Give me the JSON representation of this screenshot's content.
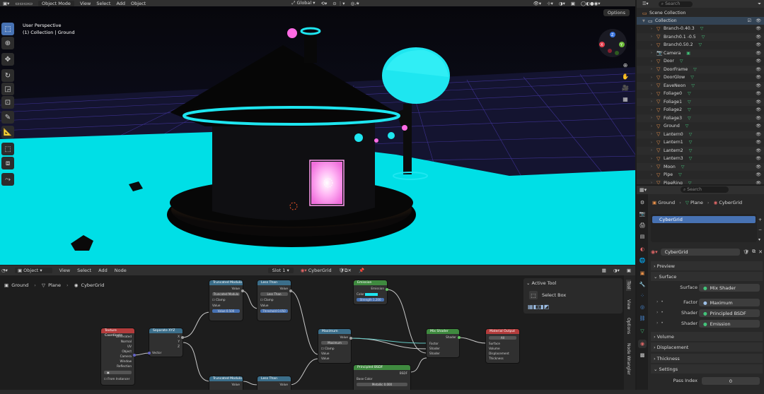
{
  "viewport_header": {
    "mode": "Object Mode",
    "menus": [
      "View",
      "Select",
      "Add",
      "Object"
    ],
    "transform_orientation": "Global",
    "options_label": "Options"
  },
  "viewport": {
    "title": "User Perspective",
    "subtitle": "(1) Collection | Ground",
    "colors": {
      "floor": "#00e0e8",
      "grid": "#4a3aa8",
      "neon": "#1ee6f0",
      "door": "#ff9cf0",
      "pink": "#ff6be4"
    },
    "gizmo_labels": [
      "X",
      "Y",
      "Z"
    ]
  },
  "outliner": {
    "search_placeholder": "Search",
    "scene_collection": "Scene Collection",
    "collection": "Collection",
    "items": [
      "Branch-0.40.3",
      "Branch0.1 -0.5",
      "Branch0.50.2",
      "Camera",
      "Door",
      "DoorFrame",
      "DoorGlow",
      "EaveNeon",
      "Foliage0",
      "Foliage1",
      "Foliage2",
      "Foliage3",
      "Ground",
      "Lantern0",
      "Lantern1",
      "Lantern2",
      "Lantern3",
      "Moon",
      "Pipe",
      "PipeRing"
    ]
  },
  "properties": {
    "search_placeholder": "Search",
    "breadcrumb": [
      "Ground",
      "Plane",
      "CyberGrid"
    ],
    "material_slot": "CyberGrid",
    "material_name": "CyberGrid",
    "sections": {
      "preview": "Preview",
      "surface": "Surface",
      "volume": "Volume",
      "displacement": "Displacement",
      "thickness": "Thickness",
      "settings": "Settings"
    },
    "surface_label": "Surface",
    "surface_value": "Mix Shader",
    "rows": [
      {
        "label": "Factor",
        "value": "Maximum"
      },
      {
        "label": "Shader",
        "value": "Principled BSDF"
      },
      {
        "label": "Shader",
        "value": "Emission"
      }
    ],
    "pass_index_label": "Pass Index",
    "pass_index_value": "0"
  },
  "node_header": {
    "mode": "Object",
    "menus": [
      "View",
      "Select",
      "Add",
      "Node"
    ],
    "slot": "Slot 1",
    "material": "CyberGrid"
  },
  "node_editor": {
    "breadcrumb": [
      "Ground",
      "Plane",
      "CyberGrid"
    ],
    "active_tool_title": "Active Tool",
    "active_tool_name": "Select Box",
    "side_tabs": [
      "Tool",
      "View",
      "Options",
      "Node Wrangler"
    ],
    "nodes": {
      "texcoord": {
        "title": "Texture Coordinate",
        "rows": [
          "Generated",
          "Normal",
          "UV",
          "Object",
          "Camera",
          "Window",
          "Reflection"
        ],
        "extra": "From Instancer"
      },
      "separate": {
        "title": "Separate XYZ",
        "rows": [
          "X",
          "Y",
          "Z"
        ],
        "input": "Vector"
      },
      "trunc1": {
        "title": "Truncated Modulo",
        "out": "Value",
        "mode": "Truncated Modulo",
        "clamp": "Clamp",
        "in": "Value",
        "field": "Value   0.500"
      },
      "trunc2": {
        "title": "Truncated Modulo",
        "out": "Value"
      },
      "less1": {
        "title": "Less Than",
        "out": "Value",
        "mode": "Less Than",
        "clamp": "Clamp",
        "in": "Value",
        "field": "Threshold  0.050"
      },
      "less2": {
        "title": "Less Than",
        "out": "Value"
      },
      "maximum": {
        "title": "Maximum",
        "out": "Value",
        "mode": "Maximum",
        "clamp": "Clamp",
        "in1": "Value",
        "in2": "Value"
      },
      "emission": {
        "title": "Emission",
        "out": "Emission",
        "color": "Color",
        "strength": "Strength  1.200"
      },
      "principled": {
        "title": "Principled BSDF",
        "out": "BSDF",
        "row1": "Base Color",
        "row2": "Metallic  0.000"
      },
      "mix": {
        "title": "Mix Shader",
        "out": "Shader",
        "in1": "Factor",
        "in2": "Shader",
        "in3": "Shader"
      },
      "output": {
        "title": "Material Output",
        "target": "All",
        "rows": [
          "Surface",
          "Volume",
          "Displacement",
          "Thickness"
        ]
      }
    }
  }
}
